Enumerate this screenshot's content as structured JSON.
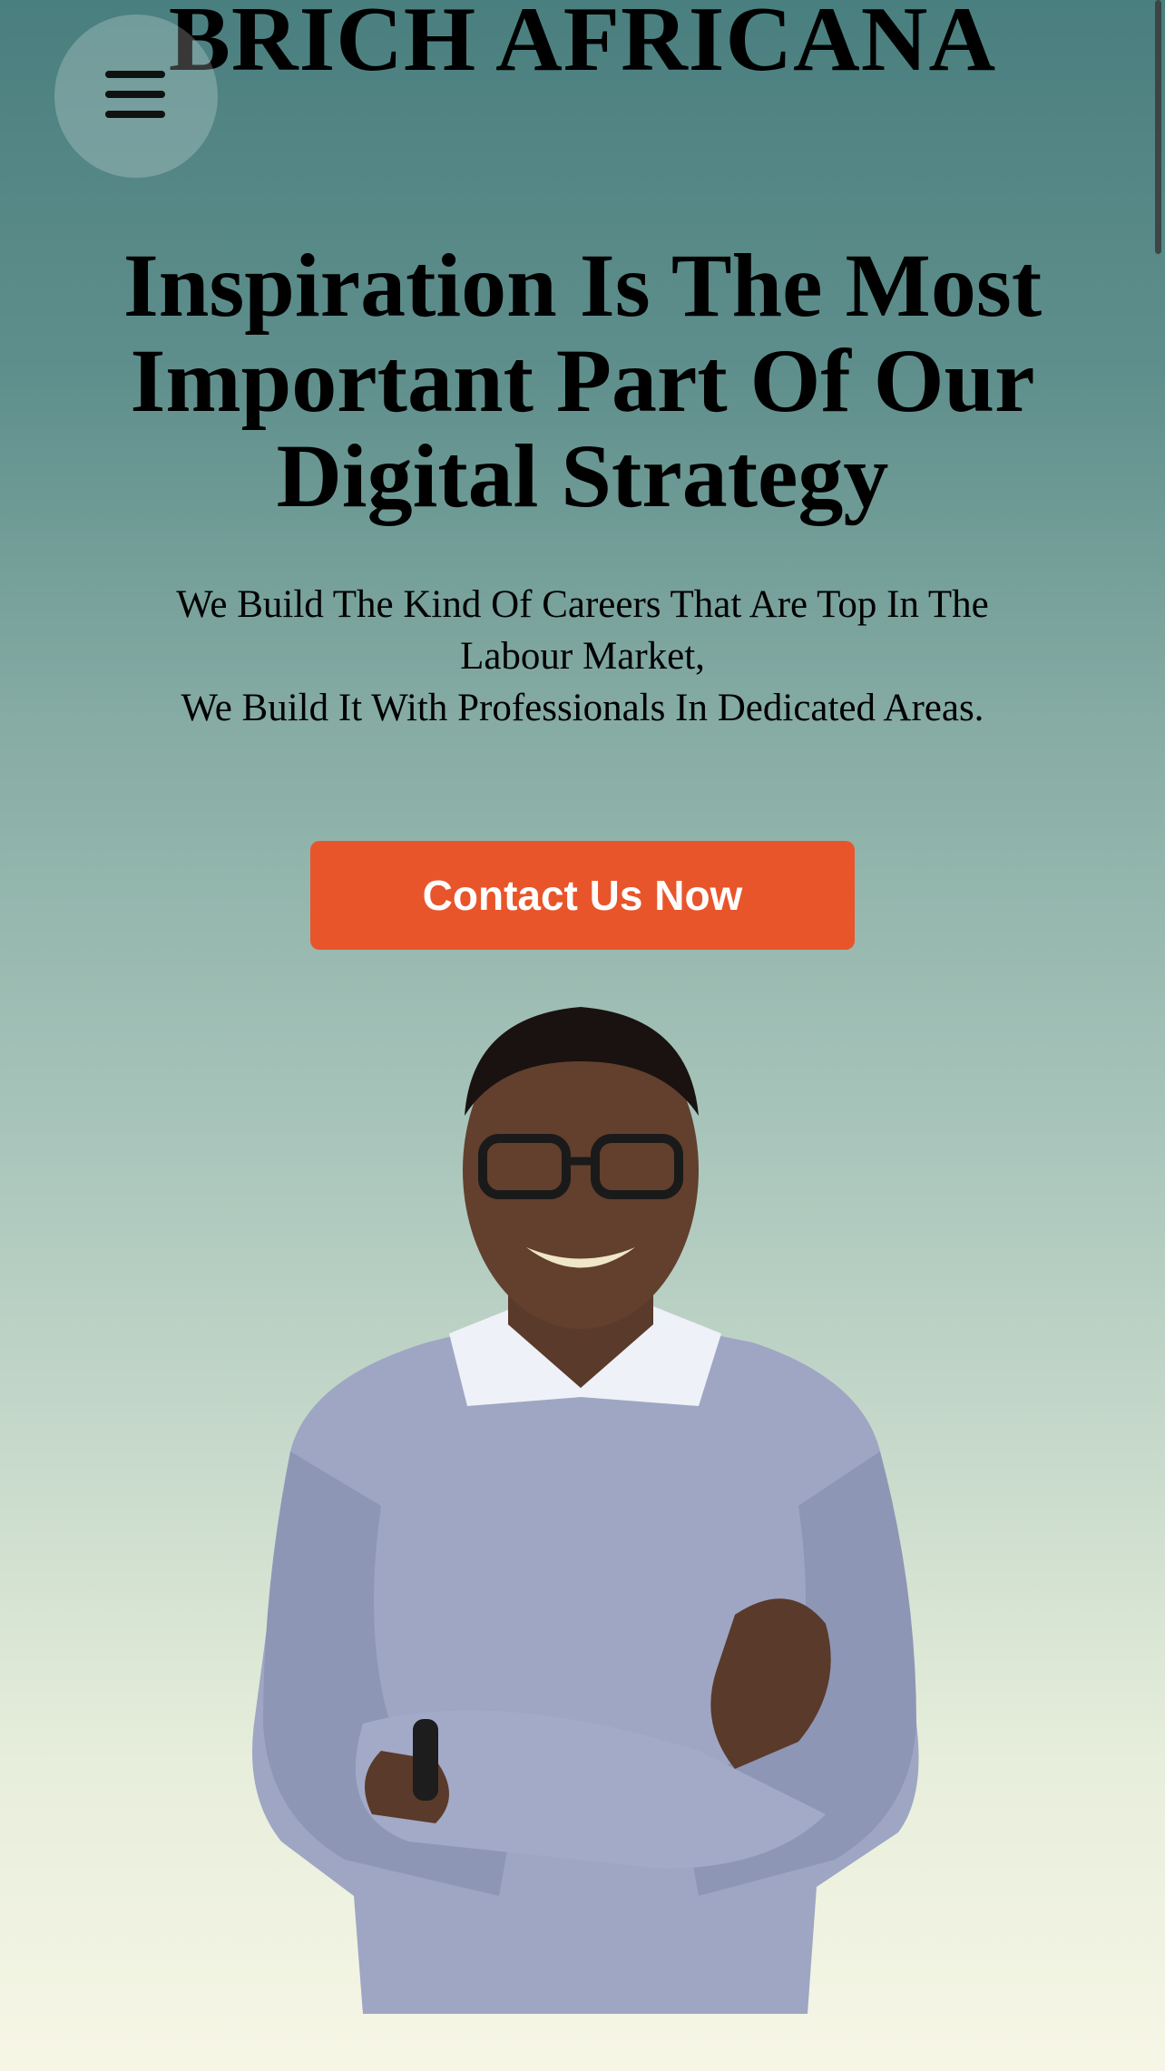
{
  "header": {
    "brand": "BRICH AFRICANA",
    "menu_icon": "hamburger-menu-icon"
  },
  "hero": {
    "title": "Inspiration Is The Most Important Part Of Our Digital Strategy",
    "subtitle_line1": "We Build The Kind Of Careers That Are Top In The Labour Market,",
    "subtitle_line2": "We Build It With Professionals In Dedicated Areas.",
    "cta_label": "Contact Us Now",
    "image_alt": "smiling man with glasses and crossed arms"
  },
  "colors": {
    "accent": "#e8552b",
    "gradient_top": "#4a7f7f",
    "gradient_bottom": "#f7f6e6"
  }
}
